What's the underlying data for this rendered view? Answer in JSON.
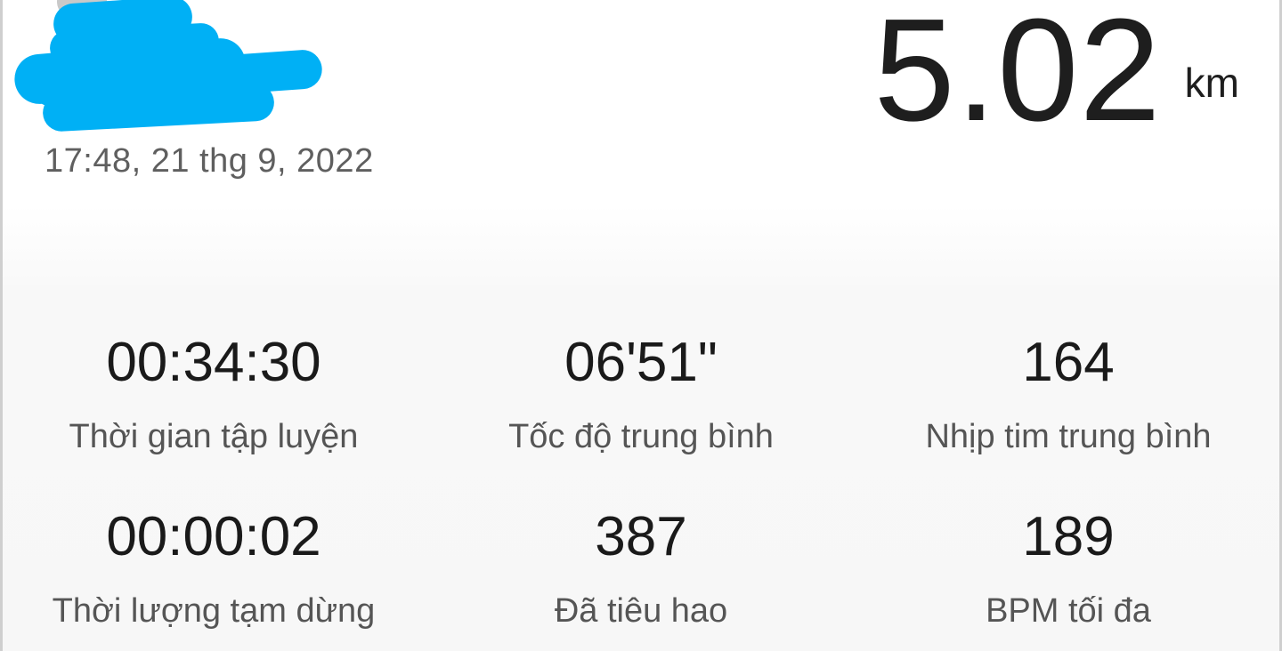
{
  "workout": {
    "timestamp": "17:48, 21 thg 9, 2022",
    "distance": {
      "value": "5.02",
      "unit": "km"
    }
  },
  "stats": [
    {
      "value": "00:34:30",
      "label": "Thời gian tập luyện"
    },
    {
      "value": "06'51\"",
      "label": "Tốc độ trung bình"
    },
    {
      "value": "164",
      "label": "Nhịp tim trung bình"
    },
    {
      "value": "00:00:02",
      "label": "Thời lượng tạm dừng"
    },
    {
      "value": "387",
      "label": "Đã tiêu hao"
    },
    {
      "value": "189",
      "label": "BPM tối đa"
    }
  ],
  "colors": {
    "redaction": "#00b0f5",
    "text_primary": "#1a1a1a",
    "text_secondary": "#555555"
  }
}
